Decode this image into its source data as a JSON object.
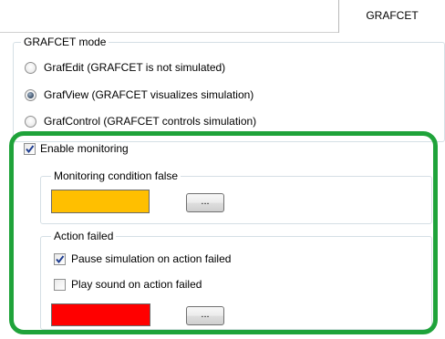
{
  "tab": {
    "label": "GRAFCET"
  },
  "grafcet_mode": {
    "legend": "GRAFCET mode",
    "options": [
      {
        "label": "GrafEdit (GRAFCET is not simulated)",
        "selected": false
      },
      {
        "label": "GrafView (GRAFCET visualizes simulation)",
        "selected": true
      },
      {
        "label": "GrafControl (GRAFCET controls simulation)",
        "selected": false
      }
    ]
  },
  "monitoring": {
    "enable_label": "Enable monitoring",
    "enabled": true,
    "condition_false": {
      "legend": "Monitoring condition false",
      "color": "#FFBF00",
      "button_label": "..."
    },
    "action_failed": {
      "legend": "Action failed",
      "pause_label": "Pause simulation on action failed",
      "pause_checked": true,
      "sound_label": "Play sound on action failed",
      "sound_checked": false,
      "color": "#FF0000",
      "button_label": "..."
    }
  },
  "highlight_color": "#1FA33A"
}
